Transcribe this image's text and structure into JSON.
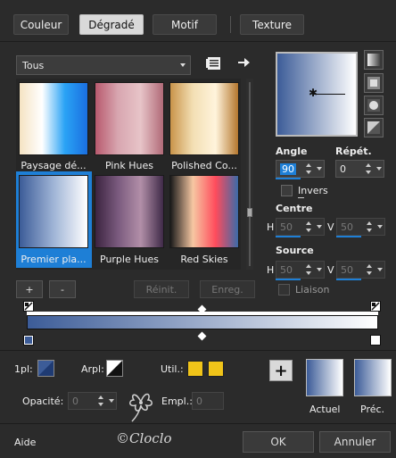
{
  "tabs": [
    {
      "label": "Couleur"
    },
    {
      "label": "Dégradé"
    },
    {
      "label": "Motif"
    },
    {
      "label": "Texture"
    }
  ],
  "category": {
    "value": "Tous"
  },
  "presets": [
    {
      "label": "Paysage dé...",
      "colors": [
        "#f5e3c3",
        "#ffffff",
        "#2aa3f5",
        "#1a6fe0"
      ]
    },
    {
      "label": "Pink Hues",
      "colors": [
        "#b85a6e",
        "#d8a6b0",
        "#e7c4c8",
        "#b16a78"
      ]
    },
    {
      "label": "Polished Co...",
      "colors": [
        "#c9944a",
        "#f3dfb4",
        "#fff4dc",
        "#b5772e"
      ]
    },
    {
      "label": "Premier pla...",
      "colors": [
        "#3c5c98",
        "#9fb4d6",
        "#ffffff"
      ]
    },
    {
      "label": "Purple Hues",
      "colors": [
        "#3c2440",
        "#7a5a7e",
        "#b28fa8",
        "#3f2a48"
      ]
    },
    {
      "label": "Red Skies",
      "colors": [
        "#1a1a1a",
        "#f6c7a2",
        "#ff4c5c",
        "#3b6aa8"
      ]
    }
  ],
  "selected_preset": "Premier pla...",
  "buttons": {
    "add": "+",
    "remove": "-",
    "reset": "Réinit.",
    "save": "Enreg.",
    "ok": "OK",
    "cancel": "Annuler",
    "add_swatch": "+"
  },
  "angle": {
    "label": "Angle",
    "value": "90"
  },
  "repeat": {
    "label": "Répét.",
    "value": "0"
  },
  "invert": {
    "label": "Invers"
  },
  "centre": {
    "label": "Centre",
    "h_label": "H",
    "h_value": "50",
    "v_label": "V",
    "v_value": "50"
  },
  "source": {
    "label": "Source",
    "h_label": "H",
    "h_value": "50",
    "v_label": "V",
    "v_value": "50"
  },
  "link": {
    "label": "Liaison"
  },
  "footer": {
    "first_label": "1pl:",
    "arpl_label": "Arpl:",
    "util_label": "Util.:",
    "opacity_label": "Opacité:",
    "opacity_value": "0",
    "empl_label": "Empl.:",
    "empl_value": "0",
    "current_label": "Actuel",
    "previous_label": "Préc.",
    "help_label": "Aide"
  },
  "watermark": "©Cloclo",
  "colors": {
    "accent": "#1e7fd6",
    "gradient_start": "#3c5c98",
    "gradient_end": "#ffffff",
    "util_color": "#f0c419"
  },
  "icons": [
    "menu-icon",
    "arrow-right-icon",
    "style-linear-icon",
    "style-rect-icon",
    "style-sunburst-icon",
    "style-radial-icon"
  ]
}
